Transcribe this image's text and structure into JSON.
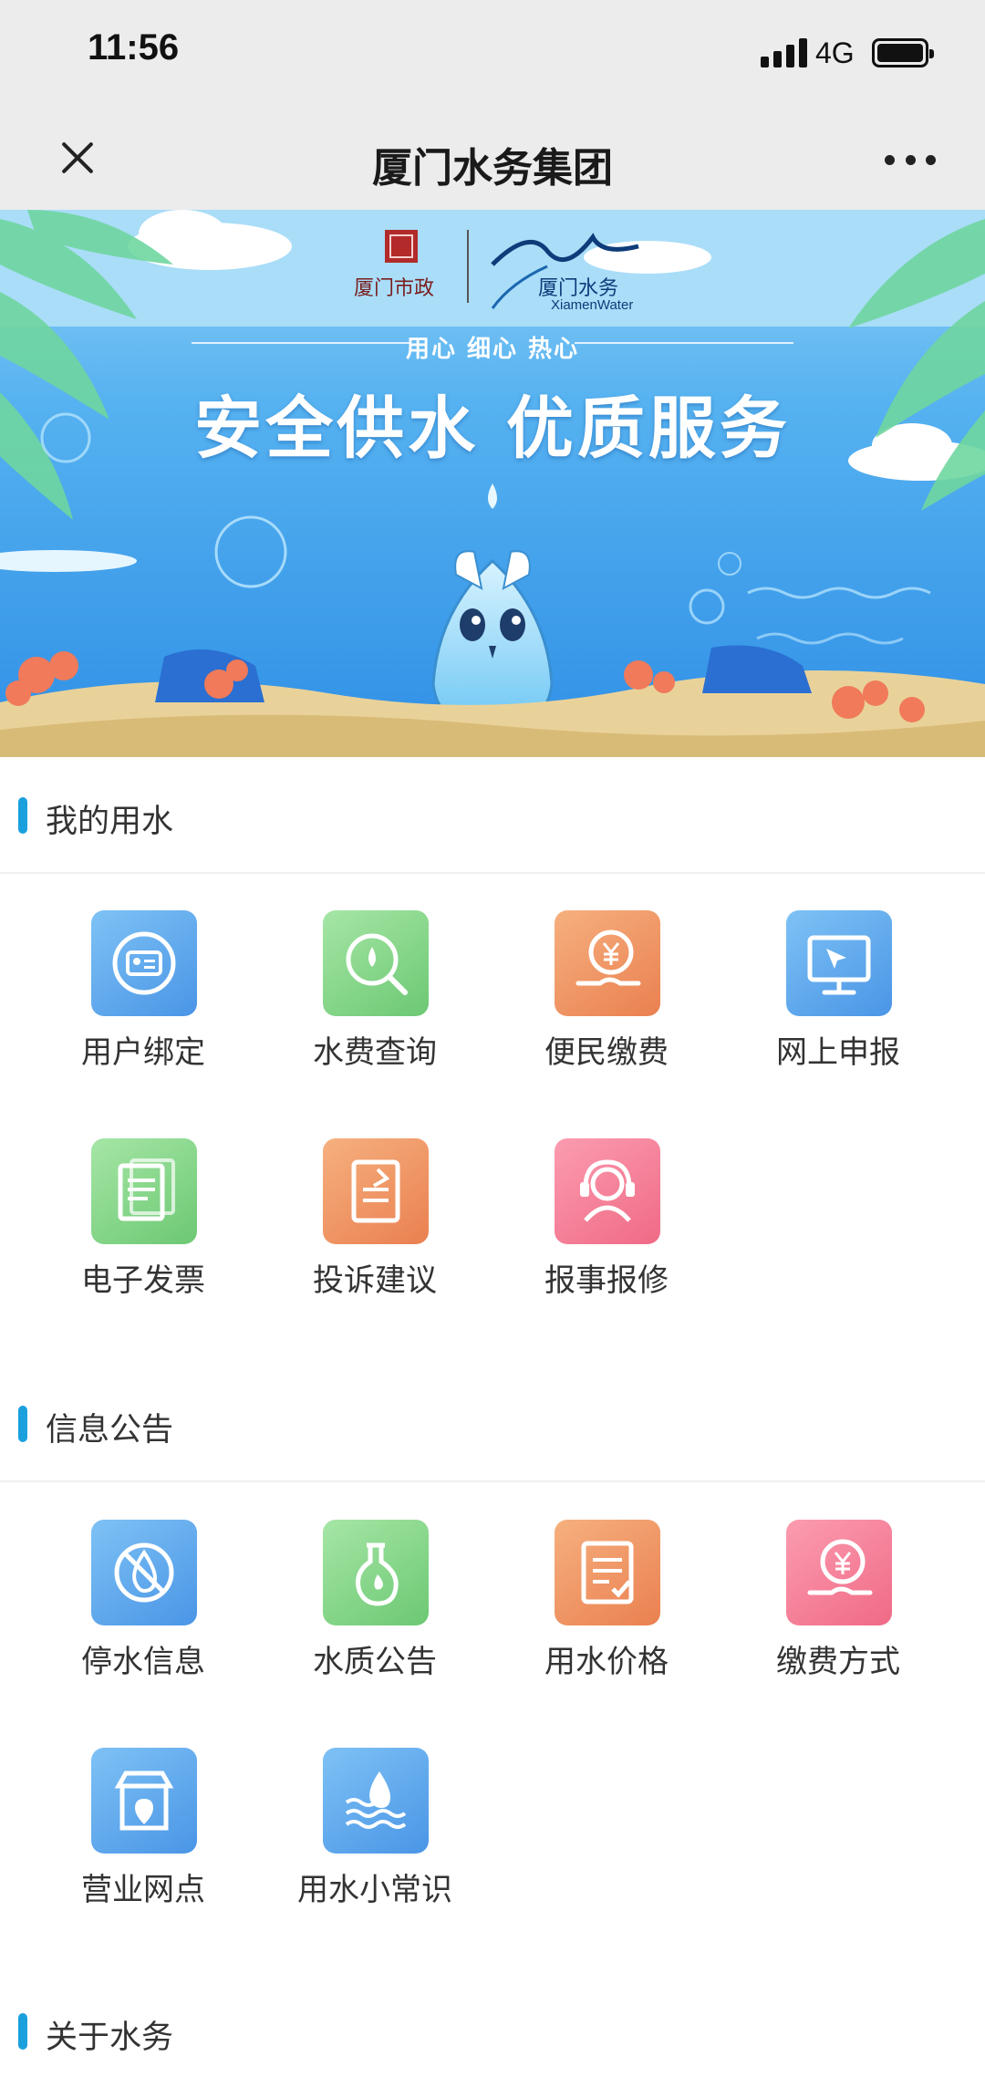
{
  "status_bar": {
    "time": "11:56",
    "network": "4G"
  },
  "nav": {
    "title": "厦门水务集团"
  },
  "banner": {
    "slogan_small": "用心 细心 热心",
    "slogan_big": "安全供水 优质服务",
    "logo_municipal": "厦门市政",
    "logo_water": "厦门水务",
    "logo_water_en": "XiamenWater"
  },
  "sections": {
    "my_water": {
      "title": "我的用水",
      "items": [
        {
          "label": "用户绑定",
          "icon": "user-binding-icon",
          "color": "#5aa6ee"
        },
        {
          "label": "水费查询",
          "icon": "fee-query-icon",
          "color": "#7fd487"
        },
        {
          "label": "便民缴费",
          "icon": "payment-icon",
          "color": "#ee905e"
        },
        {
          "label": "网上申报",
          "icon": "online-report-icon",
          "color": "#5aa6ee"
        },
        {
          "label": "电子发票",
          "icon": "e-invoice-icon",
          "color": "#7fd487"
        },
        {
          "label": "投诉建议",
          "icon": "complaint-icon",
          "color": "#ee905e"
        },
        {
          "label": "报事报修",
          "icon": "repair-support-icon",
          "color": "#f27e97"
        }
      ]
    },
    "notices": {
      "title": "信息公告",
      "items": [
        {
          "label": "停水信息",
          "icon": "water-outage-icon",
          "color": "#5aa6ee"
        },
        {
          "label": "水质公告",
          "icon": "water-quality-icon",
          "color": "#7fd487"
        },
        {
          "label": "用水价格",
          "icon": "water-price-icon",
          "color": "#ee905e"
        },
        {
          "label": "缴费方式",
          "icon": "payment-method-icon",
          "color": "#f27e97"
        },
        {
          "label": "营业网点",
          "icon": "service-outlet-icon",
          "color": "#5aa6ee"
        },
        {
          "label": "用水小常识",
          "icon": "water-tips-icon",
          "color": "#5aa6ee"
        }
      ]
    },
    "about": {
      "title": "关于水务"
    }
  }
}
